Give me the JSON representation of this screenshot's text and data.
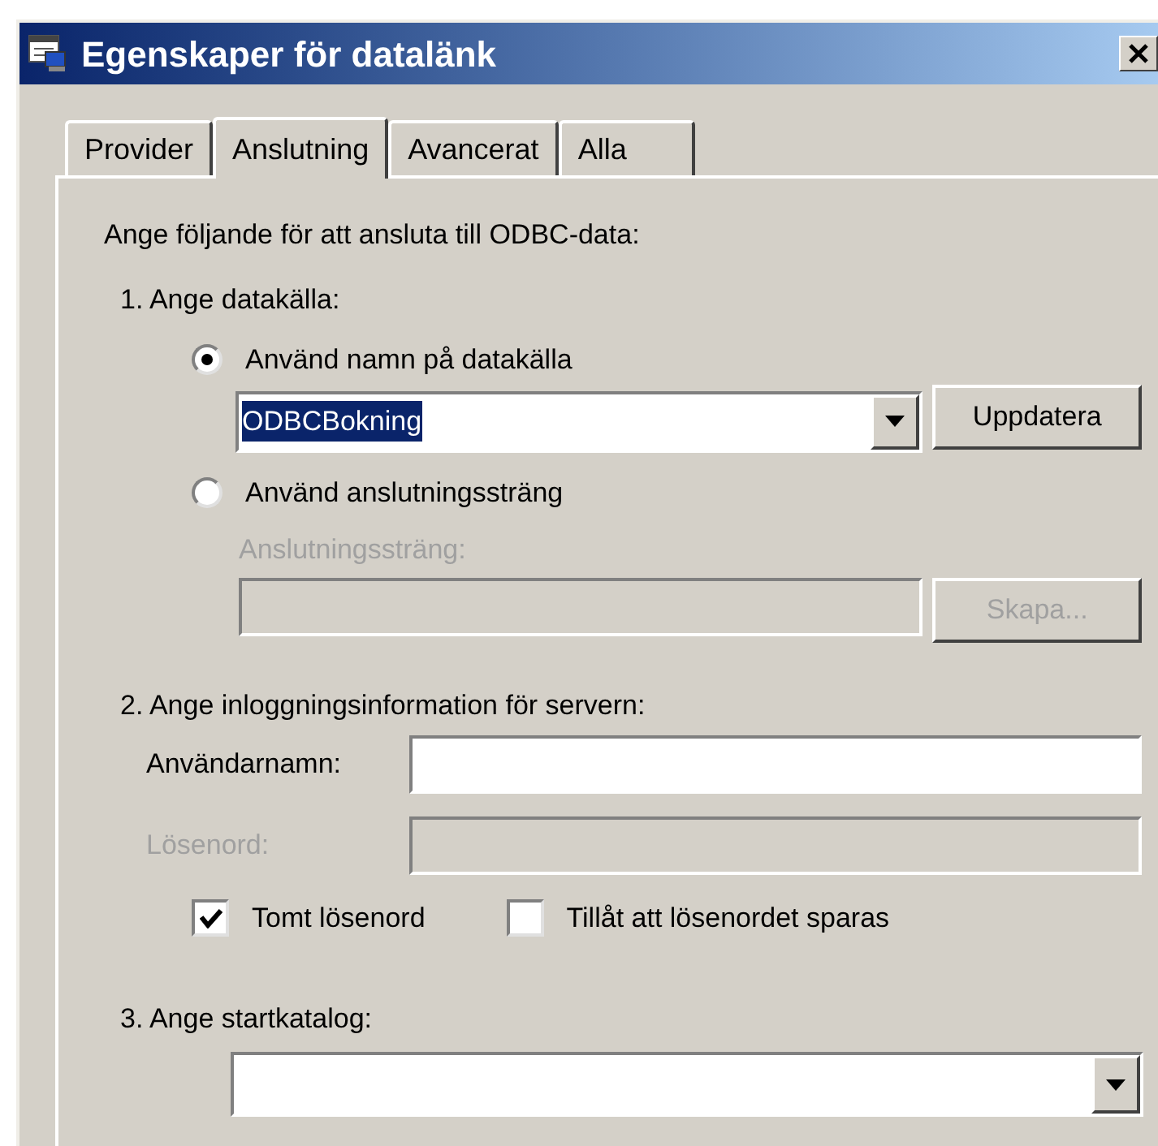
{
  "window": {
    "title": "Egenskaper för datalänk"
  },
  "tabs": [
    {
      "label": "Provider",
      "selected": false
    },
    {
      "label": "Anslutning",
      "selected": true
    },
    {
      "label": "Avancerat",
      "selected": false
    },
    {
      "label": "Alla",
      "selected": false
    }
  ],
  "intro": "Ange följande för att ansluta till ODBC-data:",
  "step1": {
    "heading": "1. Ange datakälla:",
    "options": [
      {
        "label": "Använd namn på datakälla",
        "selected": true
      },
      {
        "label": "Använd anslutningssträng",
        "selected": false
      }
    ],
    "dsn_combo": {
      "value": "ODBCBokning",
      "highlighted": true
    },
    "refresh_button": {
      "label": "Uppdatera",
      "disabled": false
    },
    "string_label": {
      "text": "Anslutningssträng:",
      "disabled": true
    },
    "string_field": {
      "disabled": true
    },
    "build_button": {
      "label": "Skapa...",
      "disabled": true
    }
  },
  "step2": {
    "heading": "2. Ange inloggningsinformation för servern:",
    "fields": [
      {
        "label": "Användarnamn:",
        "disabled": false
      },
      {
        "label": "Lösenord:",
        "disabled": true
      }
    ],
    "checkboxes": [
      {
        "label": "Tomt lösenord",
        "checked": true
      },
      {
        "label": "Tillåt att lösenordet sparas",
        "checked": false
      }
    ]
  },
  "step3": {
    "heading": "3. Ange startkatalog:"
  }
}
